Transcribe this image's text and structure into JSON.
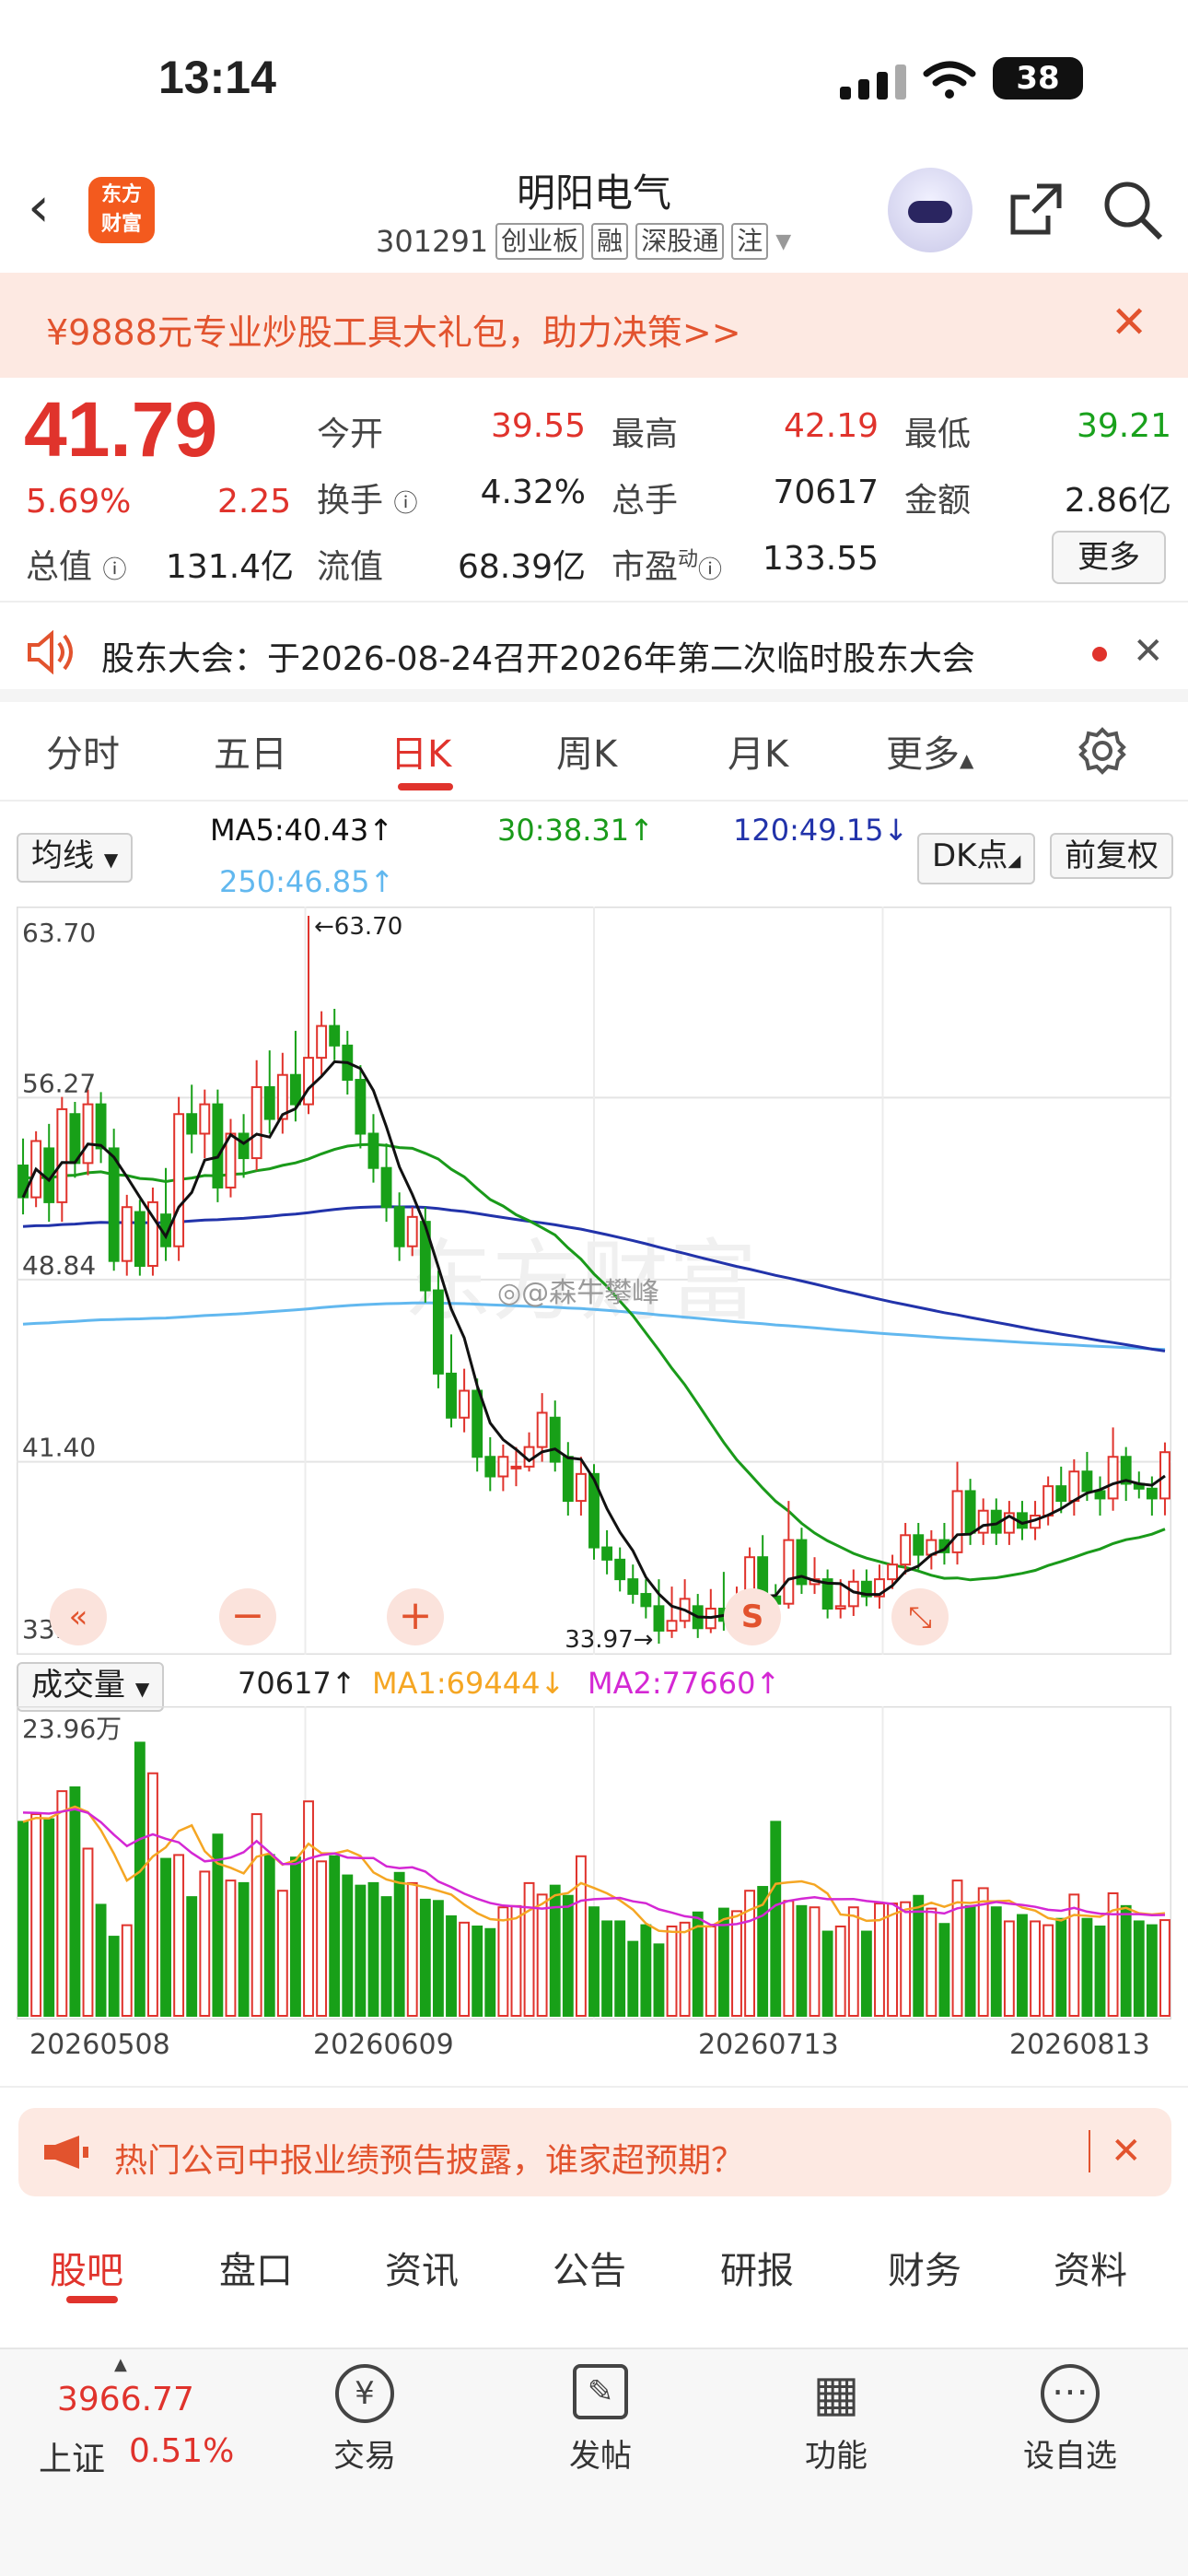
{
  "status": {
    "time": "13:14",
    "battery": "38"
  },
  "header": {
    "logo_line1": "东方",
    "logo_line2": "财富",
    "stock_name": "明阳电气",
    "stock_code": "301291",
    "tags": [
      "创业板",
      "融",
      "深股通",
      "注"
    ]
  },
  "promo": {
    "text": "¥9888元专业炒股工具大礼包，助力决策>>"
  },
  "quote": {
    "price": "41.79",
    "change_pct": "5.69%",
    "change": "2.25",
    "open_label": "今开",
    "open": "39.55",
    "high_label": "最高",
    "high": "42.19",
    "low_label": "最低",
    "low": "39.21",
    "turnover_label": "换手",
    "turnover": "4.32%",
    "volume_label": "总手",
    "volume": "70617",
    "amount_label": "金额",
    "amount": "2.86亿",
    "mktcap_label": "总值",
    "mktcap": "131.4亿",
    "float_label": "流值",
    "float": "68.39亿",
    "pe_label": "市盈",
    "pe_sup": "动",
    "pe": "133.55",
    "more": "更多"
  },
  "notice": {
    "text": "股东大会：于2026-08-24召开2026年第二次临时股东大会"
  },
  "chart_tabs": [
    "分时",
    "五日",
    "日K",
    "周K",
    "月K",
    "更多"
  ],
  "ma": {
    "selector": "均线",
    "ma5": "MA5:40.43↑",
    "ma30": "30:38.31↑",
    "ma120": "120:49.15↓",
    "ma250": "250:46.85↑",
    "dk": "DK点",
    "adjust": "前复权",
    "colors": {
      "ma5": "#111111",
      "ma30": "#1a9a1a",
      "ma120": "#2233aa",
      "ma250": "#62b8ef"
    }
  },
  "volume_bar": {
    "selector": "成交量",
    "vol": "70617↑",
    "ma1": "MA1:69444↓",
    "ma2": "MA2:77660↑",
    "max_label": "23.96万",
    "colors": {
      "ma1": "#f5a623",
      "ma2": "#d428d4"
    }
  },
  "chart_data": {
    "type": "candlestick",
    "y_ticks": [
      "63.70",
      "56.27",
      "48.84",
      "41.40",
      "33.97"
    ],
    "ylim": [
      33.97,
      63.7
    ],
    "high_marker": "←63.70",
    "low_marker": "33.97→",
    "x_ticks": [
      "20260508",
      "20260609",
      "20260713",
      "20260813"
    ],
    "candles": [
      [
        53.5,
        52.2,
        54.6,
        51.5
      ],
      [
        52.2,
        54.5,
        54.9,
        51.8
      ],
      [
        54.2,
        52.0,
        55.2,
        51.2
      ],
      [
        52.0,
        55.8,
        56.3,
        51.2
      ],
      [
        55.6,
        53.6,
        56.1,
        53.0
      ],
      [
        53.6,
        56.0,
        56.6,
        53.1
      ],
      [
        56.0,
        54.2,
        56.5,
        53.6
      ],
      [
        54.2,
        49.6,
        55.0,
        49.2
      ],
      [
        49.6,
        51.8,
        52.3,
        49.0
      ],
      [
        51.6,
        49.4,
        52.1,
        49.0
      ],
      [
        49.4,
        52.0,
        52.6,
        49.0
      ],
      [
        51.5,
        50.2,
        53.4,
        49.6
      ],
      [
        50.2,
        55.6,
        56.3,
        49.6
      ],
      [
        55.6,
        54.8,
        56.8,
        54.0
      ],
      [
        54.8,
        56.0,
        56.6,
        53.8
      ],
      [
        56.0,
        52.6,
        56.6,
        52.0
      ],
      [
        52.6,
        54.8,
        55.4,
        52.2
      ],
      [
        54.8,
        53.8,
        55.6,
        53.0
      ],
      [
        53.8,
        56.7,
        57.8,
        53.3
      ],
      [
        56.7,
        55.4,
        58.2,
        54.8
      ],
      [
        55.4,
        57.2,
        58.1,
        54.8
      ],
      [
        57.2,
        56.0,
        59.0,
        55.3
      ],
      [
        56.0,
        57.9,
        63.7,
        55.6
      ],
      [
        57.9,
        59.2,
        59.8,
        57.2
      ],
      [
        59.2,
        58.4,
        59.9,
        57.8
      ],
      [
        58.4,
        57.0,
        59.0,
        56.4
      ],
      [
        57.0,
        54.8,
        57.6,
        54.2
      ],
      [
        54.8,
        53.4,
        55.6,
        52.8
      ],
      [
        53.4,
        51.8,
        54.4,
        51.2
      ],
      [
        51.8,
        50.2,
        52.4,
        49.6
      ],
      [
        50.2,
        51.4,
        51.8,
        49.8
      ],
      [
        51.2,
        48.4,
        51.8,
        47.9
      ],
      [
        48.4,
        45.0,
        49.2,
        44.4
      ],
      [
        45.0,
        43.2,
        46.6,
        42.8
      ],
      [
        43.2,
        44.3,
        45.2,
        42.6
      ],
      [
        44.3,
        41.6,
        44.8,
        41.0
      ],
      [
        41.6,
        40.8,
        42.4,
        40.2
      ],
      [
        40.8,
        41.6,
        42.1,
        40.2
      ],
      [
        41.2,
        41.2,
        42.0,
        40.4
      ],
      [
        41.2,
        42.0,
        42.6,
        41.0
      ],
      [
        42.0,
        43.4,
        44.2,
        41.4
      ],
      [
        43.2,
        41.4,
        43.9,
        41.0
      ],
      [
        41.6,
        39.8,
        42.2,
        39.2
      ],
      [
        39.8,
        40.9,
        41.6,
        39.2
      ],
      [
        40.9,
        37.9,
        41.3,
        37.4
      ],
      [
        37.9,
        37.4,
        38.6,
        36.8
      ],
      [
        37.4,
        36.6,
        37.9,
        36.1
      ],
      [
        36.6,
        36.0,
        37.2,
        35.6
      ],
      [
        36.0,
        35.5,
        36.6,
        35.0
      ],
      [
        35.5,
        34.5,
        36.6,
        33.97
      ],
      [
        34.5,
        34.9,
        36.3,
        34.2
      ],
      [
        34.9,
        35.8,
        36.6,
        34.6
      ],
      [
        35.5,
        34.6,
        36.0,
        34.2
      ],
      [
        34.6,
        35.4,
        36.2,
        34.4
      ],
      [
        35.4,
        34.9,
        36.9,
        34.5
      ],
      [
        34.9,
        35.8,
        36.3,
        34.6
      ],
      [
        35.8,
        37.5,
        37.9,
        35.5
      ],
      [
        37.5,
        35.9,
        38.4,
        35.4
      ],
      [
        35.9,
        35.6,
        36.4,
        35.0
      ],
      [
        35.6,
        38.2,
        39.8,
        35.4
      ],
      [
        38.2,
        36.4,
        38.7,
        36.0
      ],
      [
        36.4,
        36.6,
        37.5,
        36.0
      ],
      [
        36.6,
        35.4,
        37.0,
        35.0
      ],
      [
        35.4,
        35.5,
        36.6,
        35.0
      ],
      [
        35.5,
        36.5,
        37.0,
        35.1
      ],
      [
        36.5,
        35.9,
        37.0,
        35.5
      ],
      [
        35.9,
        36.6,
        37.2,
        35.4
      ],
      [
        36.6,
        37.2,
        37.6,
        36.2
      ],
      [
        37.2,
        38.4,
        38.9,
        36.8
      ],
      [
        38.4,
        37.6,
        38.9,
        37.0
      ],
      [
        37.6,
        38.2,
        38.6,
        37.0
      ],
      [
        38.2,
        37.7,
        38.9,
        37.2
      ],
      [
        37.7,
        40.2,
        41.4,
        37.2
      ],
      [
        40.2,
        38.5,
        40.7,
        38.0
      ],
      [
        38.5,
        39.4,
        39.9,
        38.0
      ],
      [
        39.4,
        38.5,
        39.9,
        38.0
      ],
      [
        38.5,
        39.3,
        39.8,
        38.0
      ],
      [
        39.3,
        38.7,
        39.8,
        38.2
      ],
      [
        38.7,
        39.2,
        39.8,
        38.2
      ],
      [
        39.2,
        40.4,
        40.8,
        38.8
      ],
      [
        40.4,
        39.8,
        41.2,
        39.3
      ],
      [
        39.8,
        41.0,
        41.5,
        39.2
      ],
      [
        41.0,
        40.2,
        41.8,
        39.8
      ],
      [
        40.2,
        39.9,
        40.8,
        39.2
      ],
      [
        39.9,
        41.6,
        42.8,
        39.4
      ],
      [
        41.6,
        40.5,
        42.0,
        39.8
      ],
      [
        40.5,
        40.3,
        41.0,
        39.9
      ],
      [
        40.3,
        39.9,
        40.8,
        39.2
      ],
      [
        39.9,
        41.79,
        42.19,
        39.21
      ]
    ],
    "volumes": [
      15.2,
      15.8,
      15.4,
      17.6,
      17.9,
      13.1,
      8.7,
      6.2,
      7.1,
      21.4,
      19.0,
      12.3,
      12.6,
      9.3,
      11.3,
      14.2,
      10.6,
      10.4,
      15.8,
      12.6,
      9.8,
      12.4,
      16.8,
      12.1,
      12.5,
      11.0,
      10.2,
      10.4,
      9.3,
      11.2,
      10.4,
      9.1,
      9.0,
      7.8,
      7.3,
      7.0,
      6.8,
      8.5,
      8.6,
      10.4,
      9.5,
      10.2,
      9.4,
      12.5,
      8.5,
      7.4,
      7.4,
      5.8,
      7.1,
      5.6,
      7.0,
      7.3,
      8.1,
      7.0,
      8.4,
      8.2,
      9.8,
      10.1,
      15.2,
      9.0,
      8.6,
      8.5,
      6.6,
      7.0,
      8.5,
      6.6,
      8.8,
      8.8,
      8.9,
      9.4,
      8.4,
      7.2,
      10.6,
      8.6,
      10.0,
      8.5,
      7.4,
      7.9,
      7.4,
      7.1,
      7.6,
      9.5,
      7.6,
      7.0,
      9.6,
      8.6,
      7.4,
      7.1,
      7.5
    ]
  },
  "hot": {
    "text": "热门公司中报业绩预告披露，谁家超预期？"
  },
  "bottom_tabs": [
    "股吧",
    "盘口",
    "资讯",
    "公告",
    "研报",
    "财务",
    "资料"
  ],
  "footer": {
    "index_value": "3966.77",
    "index_name": "上证",
    "index_change": "0.51%",
    "items": [
      {
        "label": "交易",
        "icon": "¥"
      },
      {
        "label": "发帖",
        "icon": "✎"
      },
      {
        "label": "功能",
        "icon": "▦"
      },
      {
        "label": "设自选",
        "icon": "⋯"
      }
    ]
  }
}
